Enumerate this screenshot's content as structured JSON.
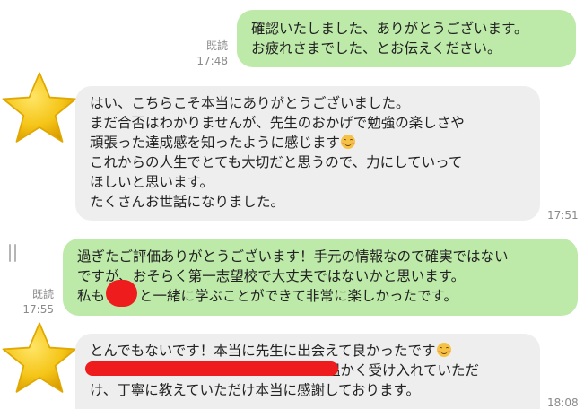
{
  "messages": [
    {
      "id": "m1",
      "side": "sent",
      "text": "確認いたしました、ありがとうございます。\nお疲れさまでした、とお伝えください。",
      "read": "既読",
      "time": "17:48"
    },
    {
      "id": "m2",
      "side": "received",
      "text_a": "はい、こちらこそ本当にありがとうございました。\nまだ合否はわかりませんが、先生のおかげで勉強の楽しさや\n頑張った達成感を知ったように感じます",
      "text_b": "\nこれからの人生でとても大切だと思うので、力にしていって\nほしいと思います。\nたくさんお世話になりました。",
      "emoji": "smiling-face-emoji",
      "time": "17:51"
    },
    {
      "id": "m3",
      "side": "sent",
      "line1": "過ぎたご評価ありがとうございます！手元の情報なので確実ではない",
      "line2": "ですが、おそらく第一志望校で大丈夫ではないかと思います。",
      "line3_a": "私も",
      "line3_b": "と一緒に学ぶことができて非常に楽しかったです。",
      "read": "既読",
      "time": "17:55"
    },
    {
      "id": "m4",
      "side": "received",
      "line1": "とんでもないです！本当に先生に出会えて良かったです",
      "line2_b": "温かく受け入れていただ",
      "line3": "け、丁寧に教えていただけ本当に感謝しております。",
      "emoji": "smiling-face-emoji",
      "time": "18:08"
    }
  ],
  "colors": {
    "sent_bubble": "#bdeaa9",
    "received_bubble": "#eeeeee",
    "meta_text": "#8a8a8a",
    "redaction": "#ee1c1c",
    "avatar_star": "#f5c518"
  },
  "avatar_icon": "star-icon"
}
